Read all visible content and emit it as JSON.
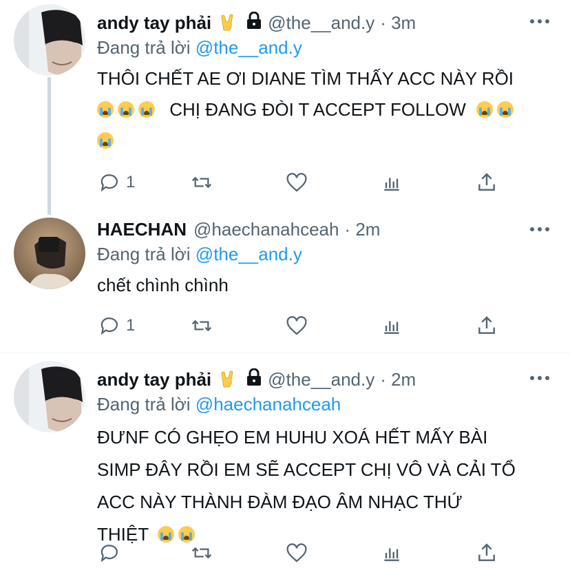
{
  "tweets": [
    {
      "name": "andy tay phải",
      "handle": "@the__and.y",
      "time": "· 3m",
      "reply_prefix": "Đang trả lời",
      "reply_to": "@the__and.y",
      "lines": [
        "THÔI CHẾT AE ƠI DIANE TÌM THẤY ACC NÀY RỒI",
        "CHỊ ĐANG ĐÒI T ACCEPT FOLLOW"
      ],
      "reply_count": "1"
    },
    {
      "name": "HAECHAN",
      "handle": "@haechanahceah",
      "time": "· 2m",
      "reply_prefix": "Đang trả lời",
      "reply_to": "@the__and.y",
      "lines": [
        "chết chình chình"
      ],
      "reply_count": "1"
    },
    {
      "name": "andy tay phải",
      "handle": "@the__and.y",
      "time": "· 2m",
      "reply_prefix": "Đang trả lời",
      "reply_to": "@haechanahceah",
      "lines": [
        "ĐƯNF CÓ GHẸO EM HUHU XOÁ HẾT MẤY BÀI",
        "SIMP ĐÂY RỒI EM SẼ ACCEPT CHỊ VÔ VÀ CẢI TỔ",
        "ACC NÀY THÀNH ĐÀM ĐẠO ÂM NHẠC THỨ",
        "THIỆT"
      ],
      "reply_count": ""
    }
  ],
  "icons": [
    "horns-emoji",
    "lock-icon",
    "more-icon",
    "reply-icon",
    "retweet-icon",
    "like-icon",
    "views-icon",
    "share-icon",
    "loudly-crying-emoji"
  ],
  "colors": {
    "text": "#0f1419",
    "secondary": "#536471",
    "link": "#1d9bf0",
    "thread_line": "#cfd9de"
  }
}
